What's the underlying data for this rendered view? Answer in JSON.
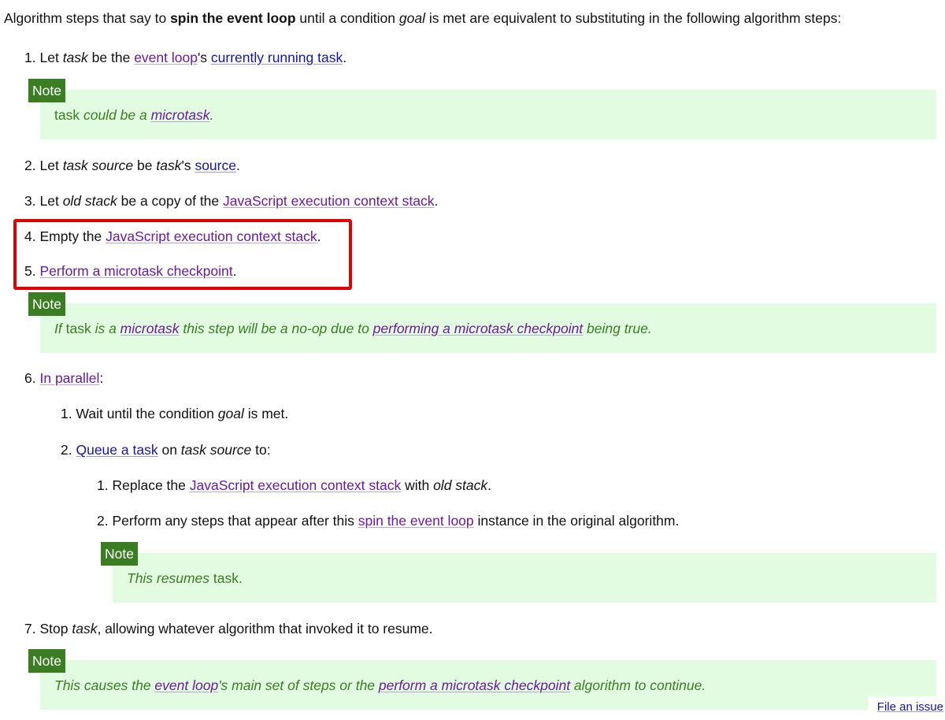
{
  "intro": {
    "part1": "Algorithm steps that say to ",
    "bold": "spin the event loop",
    "part2": " until a condition ",
    "goal": "goal",
    "part3": " is met are equivalent to substituting in the following algorithm steps:"
  },
  "note_label": "Note",
  "steps": {
    "s1": {
      "num": "1.",
      "t1": "Let ",
      "task": "task",
      "t2": " be the ",
      "link1": "event loop",
      "t3": "'s ",
      "link2": "currently running task",
      "t4": "."
    },
    "note1": {
      "t1": "task",
      "t2": " could be a ",
      "link": "microtask",
      "t3": "."
    },
    "s2": {
      "num": "2.",
      "t1": "Let ",
      "task_source": "task source",
      "t2": " be ",
      "task": "task",
      "t3": "'s ",
      "link": "source",
      "t4": "."
    },
    "s3": {
      "num": "3.",
      "t1": "Let ",
      "old_stack": "old stack",
      "t2": " be a copy of the ",
      "link": "JavaScript execution context stack",
      "t3": "."
    },
    "s4": {
      "num": "4.",
      "t1": "Empty the ",
      "link": "JavaScript execution context stack",
      "t2": "."
    },
    "s5": {
      "num": "5.",
      "link": "Perform a microtask checkpoint",
      "t1": "."
    },
    "note2": {
      "t1": "If",
      "t2": " task ",
      "t3": "is a ",
      "link1": "microtask",
      "t4": " this step will be a no-op due to ",
      "link2": "performing a microtask checkpoint",
      "t5": " being true."
    },
    "s6": {
      "num": "6.",
      "link": "In parallel",
      "t1": ":"
    },
    "s6_1": {
      "num": "1.",
      "t1": "Wait until the condition ",
      "goal": "goal",
      "t2": " is met."
    },
    "s6_2": {
      "num": "2.",
      "link": "Queue a task",
      "t1": " on ",
      "task_source": "task source",
      "t2": " to:"
    },
    "s6_2_1": {
      "num": "1.",
      "t1": "Replace the ",
      "link": "JavaScript execution context stack",
      "t2": " with ",
      "old_stack": "old stack",
      "t3": "."
    },
    "s6_2_2": {
      "num": "2.",
      "t1": "Perform any steps that appear after this ",
      "link": "spin the event loop",
      "t2": " instance in the original algorithm."
    },
    "note3": {
      "t1": "This resumes",
      "t2": " task."
    },
    "s7": {
      "num": "7.",
      "t1": "Stop ",
      "task": "task",
      "t2": ", allowing whatever algorithm that invoked it to resume."
    },
    "note4": {
      "t1": "This causes the ",
      "link1": "event loop",
      "t2": "'s main set of steps or the ",
      "link2": "perform a microtask checkpoint",
      "t3": " algorithm to continue."
    }
  },
  "footer": {
    "file_issue": "File an issue"
  },
  "colors": {
    "note_bg": "#e1fce0",
    "note_label_bg": "#3a7d22",
    "note_text": "#3a7d22",
    "link_visited": "#6a1b9a",
    "link_unvisited": "#1515a8",
    "highlight_border": "#e00000"
  }
}
